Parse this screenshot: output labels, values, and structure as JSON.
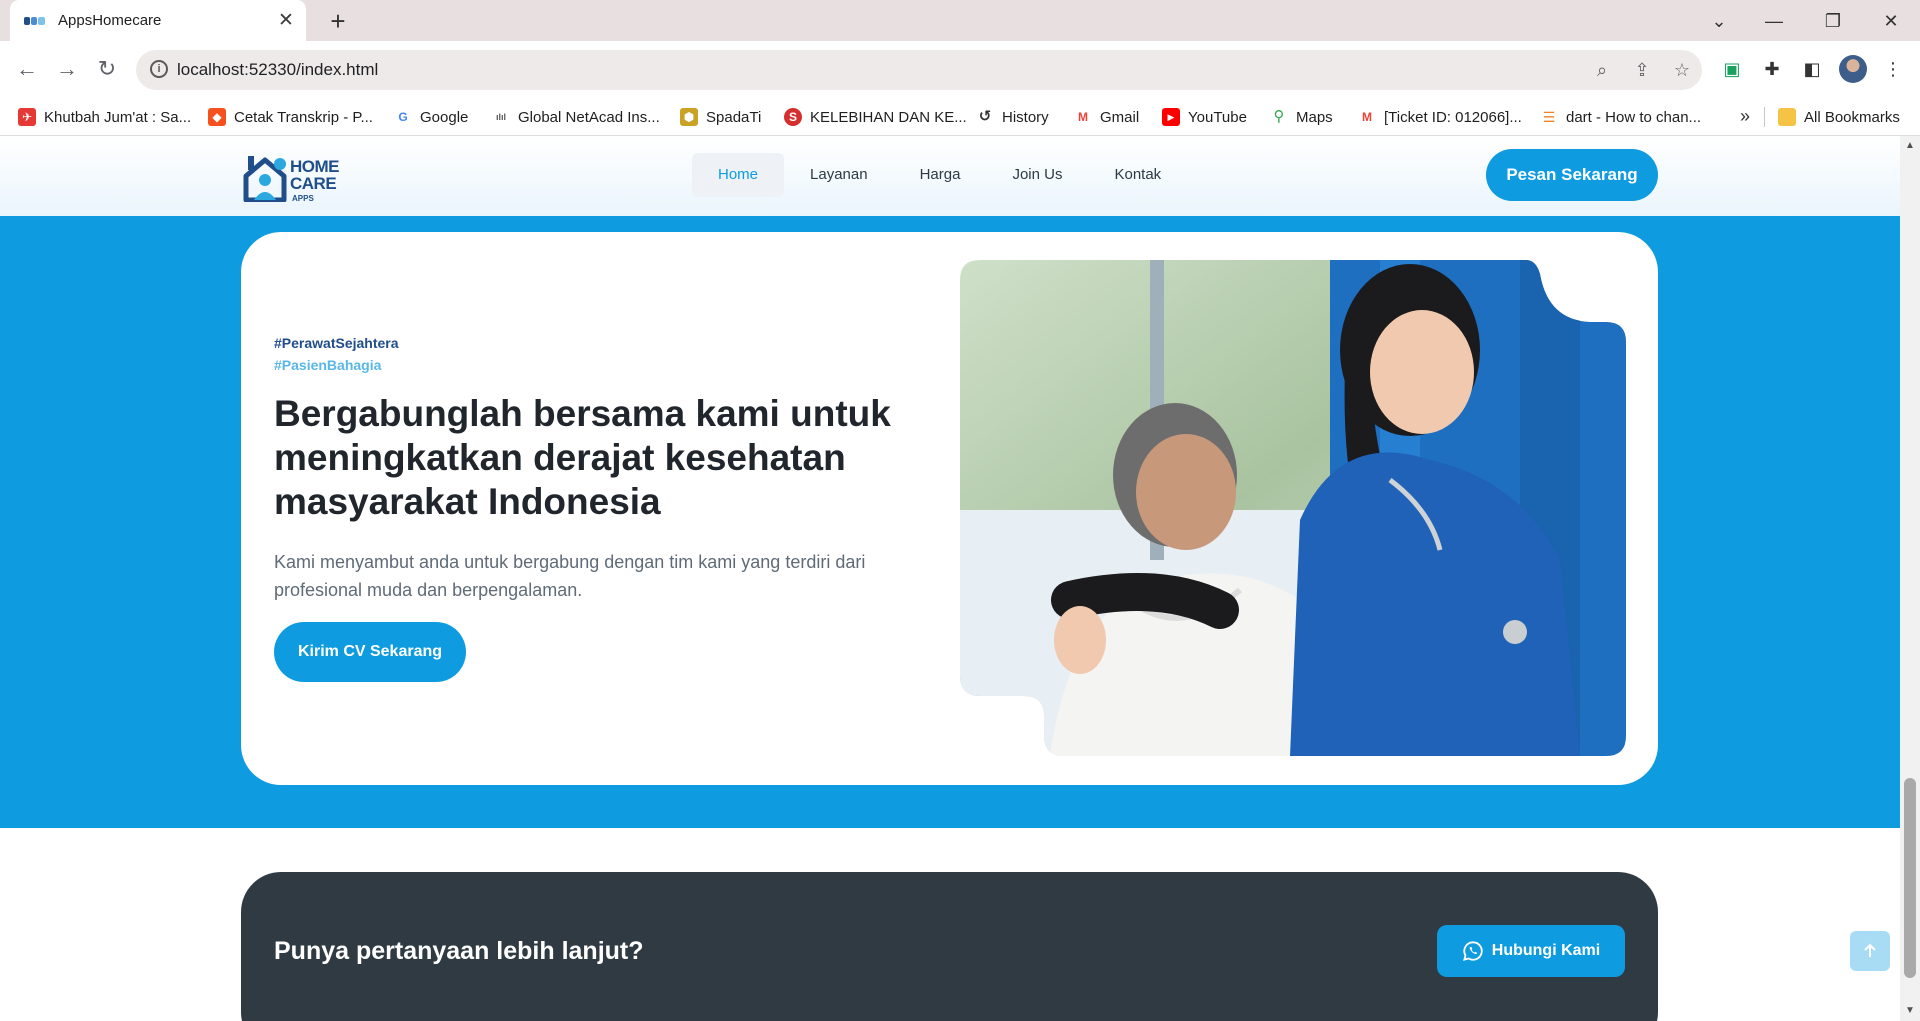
{
  "browser": {
    "tab_title": "AppsHomecare",
    "tab_close": "✕",
    "new_tab": "+",
    "url": "localhost:52330/index.html",
    "bookmarks": [
      {
        "label": "Khutbah Jum'at : Sa...",
        "icon": "plane-icon",
        "color": "#e53935"
      },
      {
        "label": "Cetak Transkrip - P...",
        "icon": "red-square-icon",
        "color": "#f4511e"
      },
      {
        "label": "Google",
        "icon": "google-icon",
        "color": "#4285f4"
      },
      {
        "label": "Global NetAcad Ins...",
        "icon": "cisco-icon",
        "color": "#555555"
      },
      {
        "label": "SpadaTi",
        "icon": "spada-icon",
        "color": "#c9a227"
      },
      {
        "label": "KELEBIHAN DAN KE...",
        "icon": "s-icon",
        "color": "#d32f2f"
      },
      {
        "label": "History",
        "icon": "history-icon",
        "color": "#333333"
      },
      {
        "label": "Gmail",
        "icon": "gmail-icon",
        "color": "#ea4335"
      },
      {
        "label": "YouTube",
        "icon": "youtube-icon",
        "color": "#ff0000"
      },
      {
        "label": "Maps",
        "icon": "maps-icon",
        "color": "#34a853"
      },
      {
        "label": "[Ticket ID: 012066]...",
        "icon": "gmail-icon",
        "color": "#ea4335"
      },
      {
        "label": "dart - How to chan...",
        "icon": "stackoverflow-icon",
        "color": "#f48024"
      }
    ],
    "bookmarks_more": "»",
    "all_bookmarks": "All Bookmarks"
  },
  "site": {
    "nav": {
      "items": [
        {
          "label": "Home",
          "active": true
        },
        {
          "label": "Layanan",
          "active": false
        },
        {
          "label": "Harga",
          "active": false
        },
        {
          "label": "Join Us",
          "active": false
        },
        {
          "label": "Kontak",
          "active": false
        }
      ],
      "cta": "Pesan Sekarang"
    },
    "logo": {
      "line1": "HOME",
      "line2": "CARE",
      "line3": "APPS"
    },
    "hero": {
      "tag1": "#PerawatSejahtera",
      "tag2": "#PasienBahagia",
      "title": "Bergabunglah bersama kami untuk meningkatkan derajat kesehatan masyarakat Indonesia",
      "description": "Kami menyambut anda untuk bergabung dengan tim kami yang terdiri dari profesional muda dan berpengalaman.",
      "button": "Kirim CV Sekarang"
    },
    "faq": {
      "title": "Punya pertanyaan lebih lanjut?",
      "button": "Hubungi Kami"
    }
  },
  "colors": {
    "primary": "#0e9be0",
    "dark": "#2f3a42",
    "brand_navy": "#1f4e8a"
  }
}
